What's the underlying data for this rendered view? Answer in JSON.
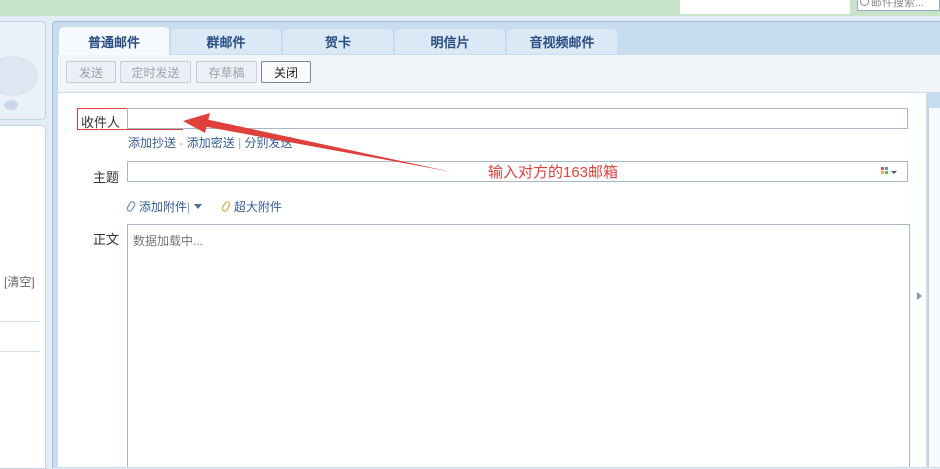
{
  "header": {
    "search_placeholder": "邮件搜索..."
  },
  "sidebar": {
    "clear_link": "[清空]"
  },
  "tabs": [
    {
      "label": "普通邮件",
      "active": true
    },
    {
      "label": "群邮件"
    },
    {
      "label": "贺卡"
    },
    {
      "label": "明信片"
    },
    {
      "label": "音视频邮件"
    }
  ],
  "toolbar": {
    "send": "发送",
    "scheduled_send": "定时发送",
    "save_draft": "存草稿",
    "close": "关闭"
  },
  "compose": {
    "to_label": "收件人",
    "to_value": "",
    "add_cc": "添加抄送",
    "add_bcc": "添加密送",
    "separate_send": "分别发送",
    "subject_label": "主题",
    "subject_value": "",
    "add_attachment": "添加附件",
    "super_attachment": "超大附件",
    "body_label": "正文",
    "body_loading": "数据加载中..."
  },
  "annotation": {
    "text": "输入对方的163邮箱",
    "color": "#e0403a"
  },
  "colors": {
    "accent": "#2a4e84",
    "link": "#355c9a",
    "annotation": "#e0403a"
  }
}
